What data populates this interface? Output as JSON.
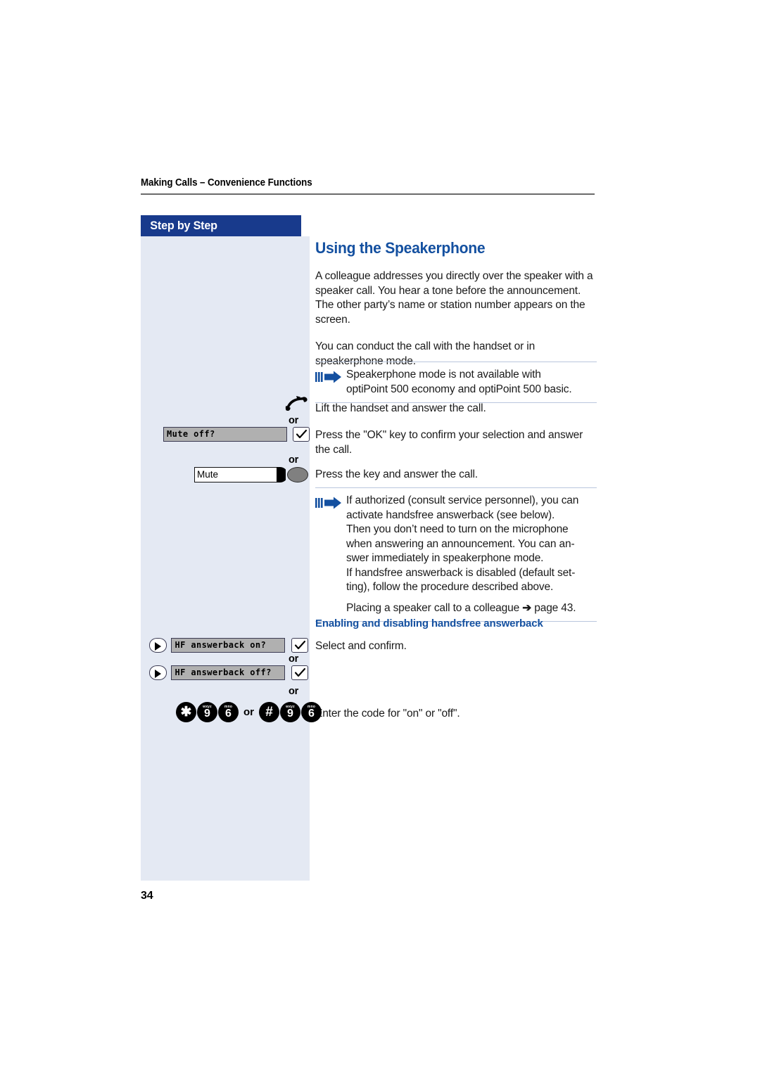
{
  "page": {
    "running_head": "Making Calls – Convenience Functions",
    "number": "34"
  },
  "sidebar": {
    "header_label": "Step by Step"
  },
  "content": {
    "section_title": "Using the Speakerphone",
    "intro_paragraph_1": "A colleague addresses you directly over the speaker with a speaker call. You hear a tone before the announcement. The other party’s name or station number appears on the screen.",
    "intro_paragraph_2": "You can conduct the call with the handset or in speakerphone mode.",
    "note_1": {
      "icon": "note-arrow-icon",
      "line_1": "Speakerphone mode is not available with",
      "line_2": "optiPoint 500 economy and optiPoint 500 basic."
    },
    "step_lift_handset": "Lift the handset and answer the call.",
    "step_press_ok": "Press the \"OK\" key to confirm your selection and answer the call.",
    "step_press_key": "Press the key and answer the call.",
    "note_2": {
      "icon": "note-arrow-icon",
      "line_1": "If authorized (consult service personnel), you can",
      "line_2": "activate handsfree answerback (see below).",
      "line_3": "Then you don’t need to turn on the microphone",
      "line_4": "when answering an announcement. You can an-",
      "line_5": "swer immediately in speakerphone mode.",
      "line_6": "If handsfree answerback is disabled (default set-",
      "line_7": "ting), follow the procedure described above.",
      "cross_ref_before": "Placing a speaker call to a colleague",
      "cross_ref_arrow": "➔",
      "cross_ref_after": "page 43."
    },
    "subsection_title": "Enabling and disabling handsfree answerback",
    "step_select_confirm": "Select and confirm.",
    "step_enter_code": "Enter the code for \"on\" or \"off\"."
  },
  "left_column": {
    "or_label": "or",
    "handset": {
      "icon": "lifted-handset-icon"
    },
    "mute_option": {
      "display_text": "Mute off?",
      "ok_key_icon": "checkmark-ok-key-icon"
    },
    "mute_key": {
      "label": "Mute",
      "key_icon": "function-key-oval-icon"
    },
    "hf_on": {
      "nav_key_icon": "rocker-right-key-icon",
      "display_text": "HF answerback on?",
      "ok_key_icon": "checkmark-ok-key-icon"
    },
    "hf_off": {
      "nav_key_icon": "rocker-right-key-icon",
      "display_text": "HF answerback off?",
      "ok_key_icon": "checkmark-ok-key-icon"
    },
    "code_keys": {
      "separator": "or",
      "sequence_a": [
        {
          "glyph": "✱",
          "letters": "",
          "name": "star-key"
        },
        {
          "glyph": "9",
          "letters": "wxyz",
          "name": "digit-9-key"
        },
        {
          "glyph": "6",
          "letters": "mno",
          "name": "digit-6-key"
        }
      ],
      "sequence_b": [
        {
          "glyph": "#",
          "letters": "",
          "name": "hash-key"
        },
        {
          "glyph": "9",
          "letters": "wxyz",
          "name": "digit-9-key"
        },
        {
          "glyph": "6",
          "letters": "mno",
          "name": "digit-6-key"
        }
      ]
    }
  },
  "colors": {
    "brand_blue": "#1450a0",
    "header_navy": "#183a8c",
    "sidebar_bg": "#e4e9f3",
    "rule_grey": "#6b6b6b",
    "note_rule": "#b9c6dd"
  }
}
